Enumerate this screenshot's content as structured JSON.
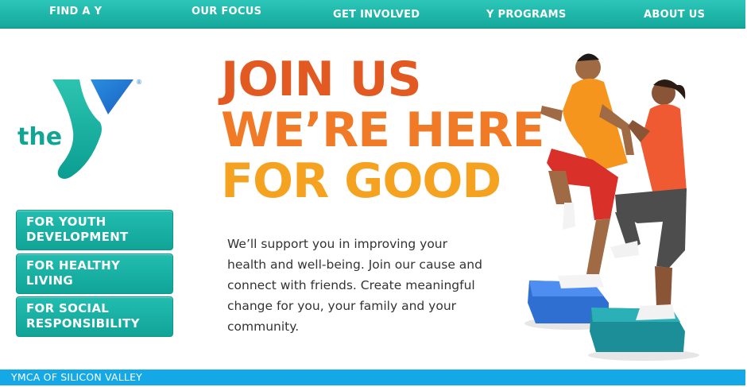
{
  "nav": {
    "items": [
      {
        "label": "FIND A Y"
      },
      {
        "label": "OUR FOCUS"
      },
      {
        "label": "GET INVOLVED"
      },
      {
        "label": "Y PROGRAMS"
      },
      {
        "label": "ABOUT US"
      }
    ]
  },
  "logo": {
    "word": "the",
    "sub": "YMCA",
    "mark": "®"
  },
  "side_buttons": [
    {
      "label": "FOR YOUTH DEVELOPMENT"
    },
    {
      "label": "FOR HEALTHY LIVING"
    },
    {
      "label": "FOR SOCIAL RESPONSIBILITY"
    }
  ],
  "headline": {
    "line1": "JOIN US",
    "line2": "WE’RE HERE",
    "line3": "FOR GOOD"
  },
  "body_copy": "We’ll support you in improving your health and well-being. Join our cause and connect with friends. Create meaningful change for you, your family and your community.",
  "footer": {
    "label": "YMCA OF SILICON VALLEY"
  },
  "colors": {
    "teal": "#14a89b",
    "blue": "#14a8e6",
    "orange_dark": "#e25a22",
    "orange": "#f07a25",
    "yellow": "#f6a221"
  }
}
